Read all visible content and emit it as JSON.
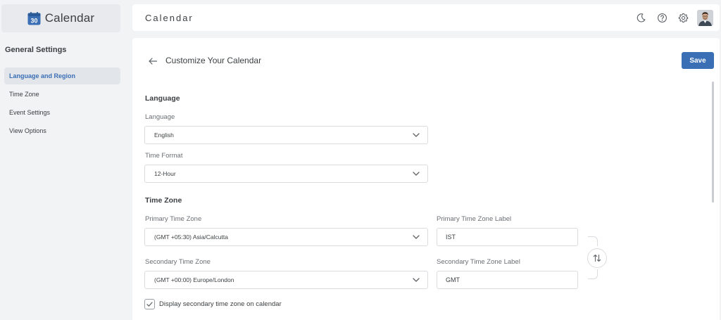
{
  "app": {
    "name": "Calendar",
    "logo_day": "30"
  },
  "sidebar": {
    "section_title": "General Settings",
    "items": [
      {
        "label": "Language and Region",
        "active": true
      },
      {
        "label": "Time Zone",
        "active": false
      },
      {
        "label": "Event Settings",
        "active": false
      },
      {
        "label": "View Options",
        "active": false
      }
    ]
  },
  "header": {
    "title": "Calendar",
    "icons": [
      "moon-icon",
      "help-icon",
      "gear-icon",
      "avatar"
    ]
  },
  "main": {
    "page_title": "Customize Your Calendar",
    "save_label": "Save",
    "language_section": {
      "title": "Language",
      "language_label": "Language",
      "language_value": "English",
      "time_format_label": "Time Format",
      "time_format_value": "12-Hour"
    },
    "timezone_section": {
      "title": "Time Zone",
      "primary_label": "Primary Time Zone",
      "primary_value": "(GMT +05:30) Asia/Calcutta",
      "primary_tz_label_label": "Primary Time Zone Label",
      "primary_tz_label_value": "IST",
      "secondary_label": "Secondary Time Zone",
      "secondary_value": "(GMT +00:00) Europe/London",
      "secondary_tz_label_label": "Secondary Time Zone Label",
      "secondary_tz_label_value": "GMT",
      "display_secondary_label": "Display secondary time zone on calendar",
      "display_secondary_checked": true
    }
  },
  "colors": {
    "accent": "#3a6fb5",
    "background": "#f1f3f4",
    "surface": "#ffffff",
    "border": "#dadce0",
    "text": "#3c4043",
    "muted": "#6b6f74"
  }
}
